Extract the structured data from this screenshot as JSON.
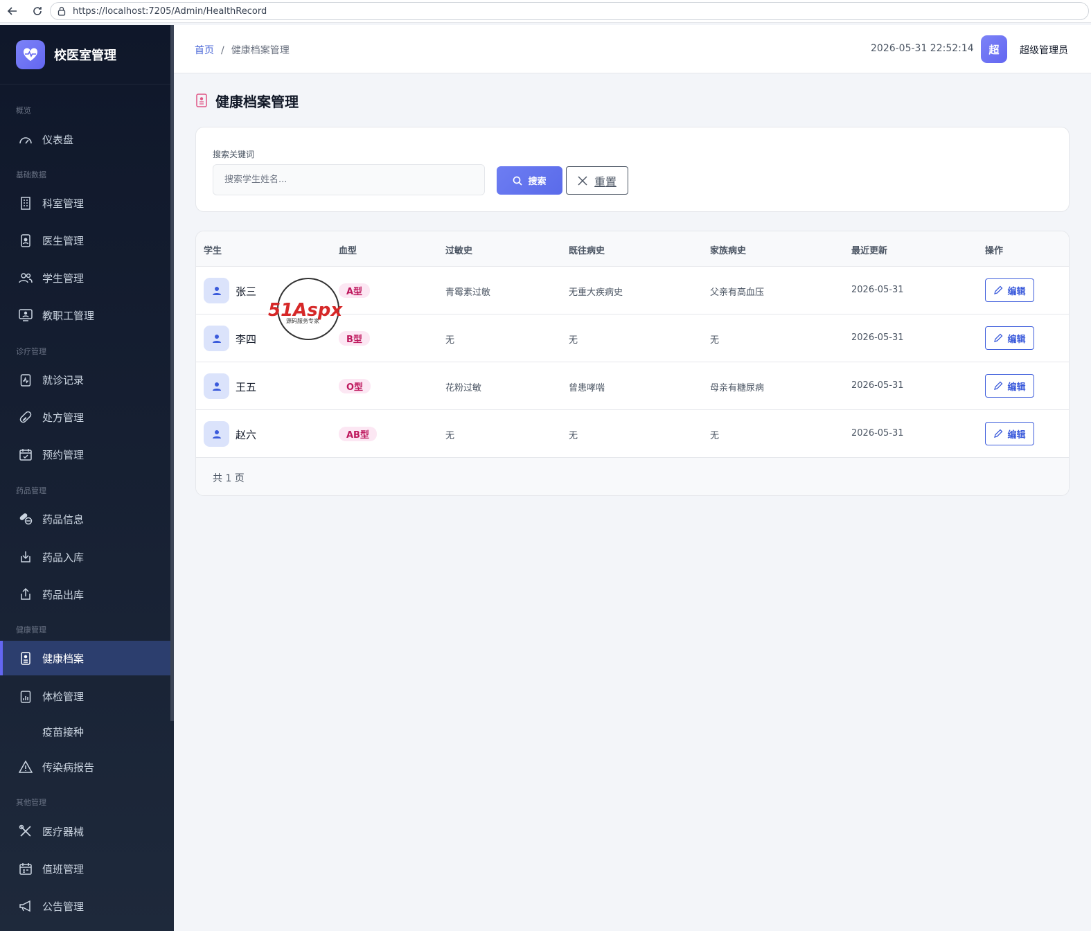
{
  "browser": {
    "url": "https://localhost:7205/Admin/HealthRecord"
  },
  "sidebar": {
    "brand": "校医室管理",
    "groups": {
      "overview": "概览",
      "basic": "基础数据",
      "clinic": "诊疗管理",
      "drug": "药品管理",
      "health": "健康管理",
      "other": "其他管理"
    },
    "items": {
      "dashboard": "仪表盘",
      "department": "科室管理",
      "doctor": "医生管理",
      "student": "学生管理",
      "staff": "教职工管理",
      "visit": "就诊记录",
      "prescription": "处方管理",
      "appointment": "预约管理",
      "drug_info": "药品信息",
      "drug_in": "药品入库",
      "drug_out": "药品出库",
      "health_record": "健康档案",
      "checkup": "体检管理",
      "vaccine": "疫苗接种",
      "epidemic": "传染病报告",
      "equipment": "医疗器械",
      "duty": "值班管理",
      "notice": "公告管理"
    }
  },
  "header": {
    "breadcrumb_home": "首页",
    "breadcrumb_sep": "/",
    "breadcrumb_current": "健康档案管理",
    "datetime": "2026-05-31 22:52:14",
    "avatar_char": "超",
    "user_name": "超级管理员"
  },
  "page": {
    "title": "健康档案管理"
  },
  "search": {
    "label": "搜索关键词",
    "placeholder": "搜索学生姓名...",
    "search_button": "搜索",
    "reset_button": "重置"
  },
  "table": {
    "columns": [
      "学生",
      "血型",
      "过敏史",
      "既往病史",
      "家族病史",
      "最近更新",
      "操作"
    ],
    "rows": [
      {
        "name": "张三",
        "blood": "A型",
        "allergy": "青霉素过敏",
        "history": "无重大疾病史",
        "family": "父亲有高血压",
        "updated": "2026-05-31",
        "action": "编辑"
      },
      {
        "name": "李四",
        "blood": "B型",
        "allergy": "无",
        "history": "无",
        "family": "无",
        "updated": "2026-05-31",
        "action": "编辑"
      },
      {
        "name": "王五",
        "blood": "O型",
        "allergy": "花粉过敏",
        "history": "曾患哮喘",
        "family": "母亲有糖尿病",
        "updated": "2026-05-31",
        "action": "编辑"
      },
      {
        "name": "赵六",
        "blood": "AB型",
        "allergy": "无",
        "history": "无",
        "family": "无",
        "updated": "2026-05-31",
        "action": "编辑"
      }
    ],
    "pager": "共 1 页"
  },
  "watermark": {
    "text": "51Aspx",
    "subtext": "源码服务专家"
  },
  "colors": {
    "accent": "#6366f1",
    "sidebar_bg": "#0f172a",
    "badge_bg": "#fce7f3",
    "badge_text": "#be185d",
    "link": "#3b5bdb"
  }
}
